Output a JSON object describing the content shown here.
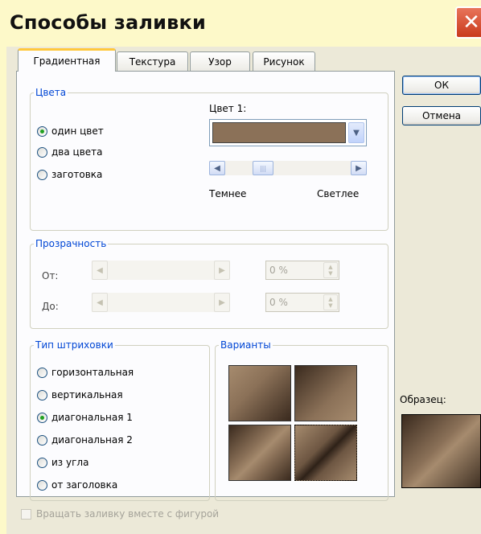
{
  "window": {
    "title": "Способы заливки",
    "close_icon": "close-icon"
  },
  "tabs": [
    {
      "label": "Градиентная",
      "active": true
    },
    {
      "label": "Текстура",
      "active": false
    },
    {
      "label": "Узор",
      "active": false
    },
    {
      "label": "Рисунок",
      "active": false
    }
  ],
  "buttons": {
    "ok": "ОК",
    "cancel": "Отмена"
  },
  "colors_group": {
    "title": "Цвета",
    "options": [
      "один цвет",
      "два цвета",
      "заготовка"
    ],
    "selected_index": 0,
    "color1_label": "Цвет 1:",
    "color1_value": "#8b7158",
    "darker_label": "Темнее",
    "lighter_label": "Светлее"
  },
  "transparency_group": {
    "title": "Прозрачность",
    "from_label": "От:",
    "to_label": "До:",
    "from_value": "0 %",
    "to_value": "0 %"
  },
  "shading_group": {
    "title": "Тип штриховки",
    "options": [
      "горизонтальная",
      "вертикальная",
      "диагональная 1",
      "диагональная 2",
      "из угла",
      "от заголовка"
    ],
    "selected_index": 2
  },
  "variants_group": {
    "title": "Варианты"
  },
  "sample_label": "Образец:",
  "rotate_checkbox": {
    "label": "Вращать заливку вместе с фигурой",
    "checked": false
  },
  "palette": {
    "fill_dark": "#3a2a1e",
    "fill_light": "#a68b6e",
    "accent_blue": "#0046d5"
  }
}
